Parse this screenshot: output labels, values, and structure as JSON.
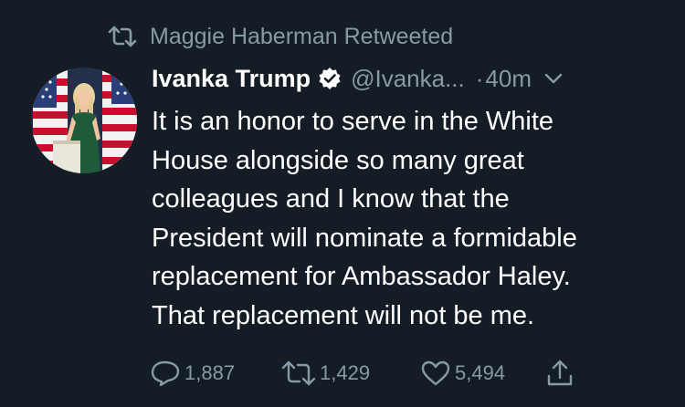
{
  "retweet_context": {
    "icon": "retweet-icon",
    "text": "Maggie Haberman Retweeted"
  },
  "tweet": {
    "avatar_icon": "profile-photo",
    "display_name": "Ivanka Trump",
    "verified_icon": "verified-badge-icon",
    "handle": "@Ivanka...",
    "separator": "·",
    "time": "40m",
    "caret_icon": "chevron-down-icon",
    "body_lines": [
      "It is an honor to serve in the White",
      "House alongside so many great",
      "colleagues and I know that the",
      "President will nominate a formidable",
      "replacement for Ambassador Haley.",
      "That replacement will not be me."
    ]
  },
  "actions": {
    "reply": {
      "icon": "reply-icon",
      "count": "1,887"
    },
    "retweet": {
      "icon": "retweet-icon",
      "count": "1,429"
    },
    "like": {
      "icon": "heart-icon",
      "count": "5,494"
    },
    "share": {
      "icon": "share-icon"
    }
  },
  "colors": {
    "background": "#141d26",
    "primary_text": "#ffffff",
    "secondary_text": "#8899a6"
  }
}
